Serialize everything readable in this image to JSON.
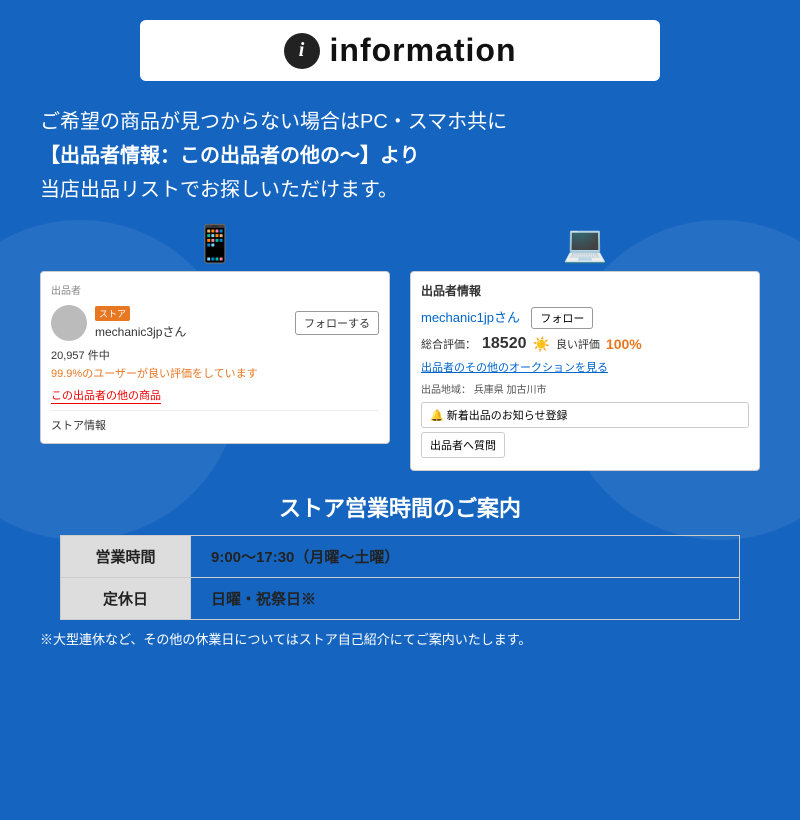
{
  "background": {
    "color": "#1565c0"
  },
  "header": {
    "icon_label": "i",
    "title": "information"
  },
  "description": {
    "line1": "ご希望の商品が見つからない場合はPC・スマホ共に",
    "line2": "【出品者情報：この出品者の他の〜】より",
    "line3": "当店出品リストでお探しいただけます。"
  },
  "left_panel": {
    "header": "出品者",
    "store_badge": "ストア",
    "username": "mechanic3jpさん",
    "follow_btn": "フォローする",
    "count": "20,957 件中",
    "review_pct": "99.9%のユーザーが良い評価をしています",
    "other_link": "この出品者の他の商品",
    "store_info": "ストア情報"
  },
  "right_panel": {
    "header": "出品者情報",
    "username": "mechanic1jpさん",
    "follow_btn": "フォロー",
    "rating_label": "総合評価：",
    "rating_num": "18520",
    "good_label": "良い評価",
    "good_pct": "100%",
    "auction_link": "出品者のその他のオークションを見る",
    "location_label": "出品地域：",
    "location_value": "兵庫県 加古川市",
    "notify_btn": "🔔 新着出品のお知らせ登録",
    "question_btn": "出品者へ質問"
  },
  "store_hours": {
    "title": "ストア営業時間のご案内",
    "rows": [
      {
        "label": "営業時間",
        "value": "9:00〜17:30（月曜〜土曜）"
      },
      {
        "label": "定休日",
        "value": "日曜・祝祭日※"
      }
    ],
    "note": "※大型連休など、その他の休業日についてはストア自己紹介にてご案内いたします。"
  }
}
